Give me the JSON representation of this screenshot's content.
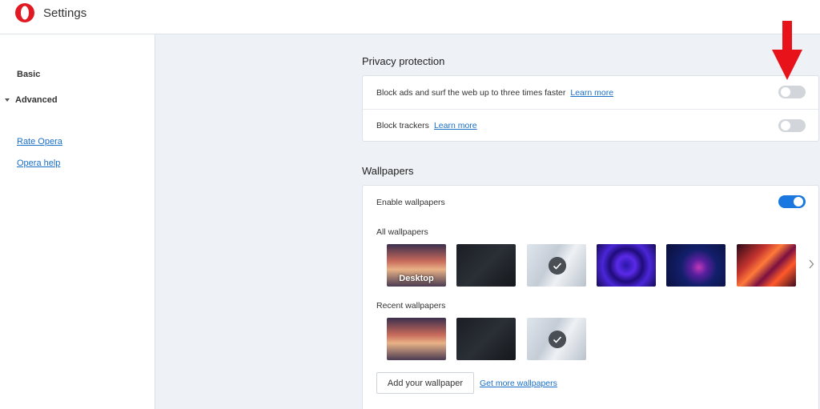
{
  "header": {
    "title": "Settings",
    "brand_color": "#e01a22"
  },
  "sidebar": {
    "items": [
      {
        "label": "Basic"
      },
      {
        "label": "Advanced",
        "expanded": true
      }
    ],
    "links": [
      {
        "label": "Rate Opera"
      },
      {
        "label": "Opera help"
      }
    ]
  },
  "privacy": {
    "title": "Privacy protection",
    "rows": [
      {
        "label": "Block ads and surf the web up to three times faster",
        "link": "Learn more",
        "enabled": false
      },
      {
        "label": "Block trackers",
        "link": "Learn more",
        "enabled": false
      }
    ]
  },
  "wallpapers": {
    "title": "Wallpapers",
    "enable_label": "Enable wallpapers",
    "enabled": true,
    "all_label": "All wallpapers",
    "recent_label": "Recent wallpapers",
    "desktop_label": "Desktop",
    "add_button": "Add your wallpaper",
    "more_link": "Get more wallpapers"
  },
  "colors": {
    "accent": "#1a78e0",
    "link": "#1a6fc6",
    "annotation_arrow": "#e8121a"
  }
}
